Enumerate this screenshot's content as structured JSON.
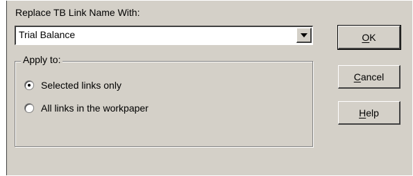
{
  "replace_label": "Replace TB Link Name With:",
  "combo": {
    "value": "Trial Balance",
    "icon": "chevron-down-icon"
  },
  "group": {
    "title": "Apply to:",
    "options": [
      {
        "label": "Selected links only",
        "selected": true
      },
      {
        "label": "All links in the workpaper",
        "selected": false
      }
    ]
  },
  "buttons": {
    "ok": {
      "mnemonic": "O",
      "rest": "K"
    },
    "cancel": {
      "mnemonic": "C",
      "rest": "ancel"
    },
    "help": {
      "mnemonic": "H",
      "rest": "elp"
    }
  },
  "colors": {
    "face": "#d4d0c8",
    "shadow": "#404040",
    "highlight": "#ffffff"
  }
}
